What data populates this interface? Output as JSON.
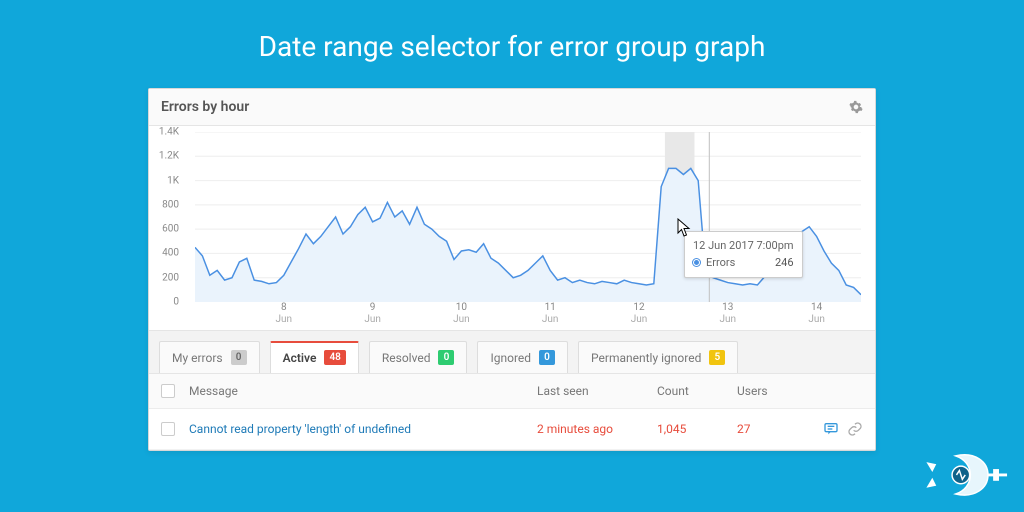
{
  "page": {
    "title": "Date range selector for error group graph"
  },
  "panel": {
    "title": "Errors by hour"
  },
  "chart_data": {
    "type": "line",
    "title": "Errors by hour",
    "xlabel": "",
    "ylabel": "",
    "ylim": [
      0,
      1400
    ],
    "yticks": [
      "0",
      "200",
      "400",
      "600",
      "800",
      "1K",
      "1.2K",
      "1.4K"
    ],
    "xticks": [
      {
        "pos": 24,
        "day": "8",
        "month": "Jun"
      },
      {
        "pos": 48,
        "day": "9",
        "month": "Jun"
      },
      {
        "pos": 72,
        "day": "10",
        "month": "Jun"
      },
      {
        "pos": 96,
        "day": "11",
        "month": "Jun"
      },
      {
        "pos": 120,
        "day": "12",
        "month": "Jun"
      },
      {
        "pos": 144,
        "day": "13",
        "month": "Jun"
      },
      {
        "pos": 168,
        "day": "14",
        "month": "Jun"
      }
    ],
    "hover_band": {
      "x_start": 127,
      "x_end": 135
    },
    "hover_tick": 139,
    "series": [
      {
        "name": "Errors",
        "color": "#4a90e2",
        "x": [
          0,
          2,
          4,
          6,
          8,
          10,
          12,
          14,
          16,
          18,
          20,
          22,
          24,
          26,
          28,
          30,
          32,
          34,
          36,
          38,
          40,
          42,
          44,
          46,
          48,
          50,
          52,
          54,
          56,
          58,
          60,
          62,
          64,
          66,
          68,
          70,
          72,
          74,
          76,
          78,
          80,
          82,
          84,
          86,
          88,
          90,
          92,
          94,
          96,
          98,
          100,
          102,
          104,
          106,
          108,
          110,
          112,
          114,
          116,
          118,
          120,
          122,
          124,
          126,
          128,
          130,
          132,
          134,
          136,
          138,
          140,
          142,
          144,
          146,
          148,
          150,
          152,
          154,
          156,
          158,
          160,
          162,
          164,
          166,
          168,
          170,
          172,
          174,
          176,
          178,
          180
        ],
        "values": [
          450,
          380,
          220,
          260,
          180,
          200,
          330,
          360,
          180,
          170,
          150,
          160,
          220,
          330,
          440,
          560,
          480,
          540,
          620,
          700,
          560,
          620,
          720,
          780,
          660,
          690,
          820,
          700,
          750,
          640,
          780,
          640,
          600,
          540,
          500,
          350,
          420,
          430,
          410,
          480,
          360,
          320,
          260,
          200,
          220,
          260,
          320,
          380,
          260,
          180,
          200,
          160,
          180,
          160,
          150,
          170,
          160,
          150,
          180,
          160,
          150,
          140,
          150,
          950,
          1100,
          1100,
          1050,
          1100,
          1000,
          260,
          200,
          180,
          160,
          150,
          140,
          150,
          140,
          210,
          360,
          480,
          560,
          540,
          580,
          620,
          540,
          420,
          320,
          260,
          140,
          120,
          60
        ]
      }
    ],
    "tooltip": {
      "time": "12 Jun 2017 7:00pm",
      "series": "Errors",
      "value": "246"
    }
  },
  "filters": {
    "tabs": [
      {
        "label": "My errors",
        "badge": "0",
        "badge_class": "b-grey"
      },
      {
        "label": "Active",
        "badge": "48",
        "badge_class": "b-red",
        "active": true
      },
      {
        "label": "Resolved",
        "badge": "0",
        "badge_class": "b-green"
      },
      {
        "label": "Ignored",
        "badge": "0",
        "badge_class": "b-blue"
      },
      {
        "label": "Permanently ignored",
        "badge": "5",
        "badge_class": "b-amber"
      }
    ]
  },
  "table": {
    "headers": {
      "message": "Message",
      "last_seen": "Last seen",
      "count": "Count",
      "users": "Users"
    },
    "rows": [
      {
        "message": "Cannot read property 'length' of undefined",
        "last_seen": "2 minutes ago",
        "count": "1,045",
        "users": "27"
      }
    ]
  }
}
